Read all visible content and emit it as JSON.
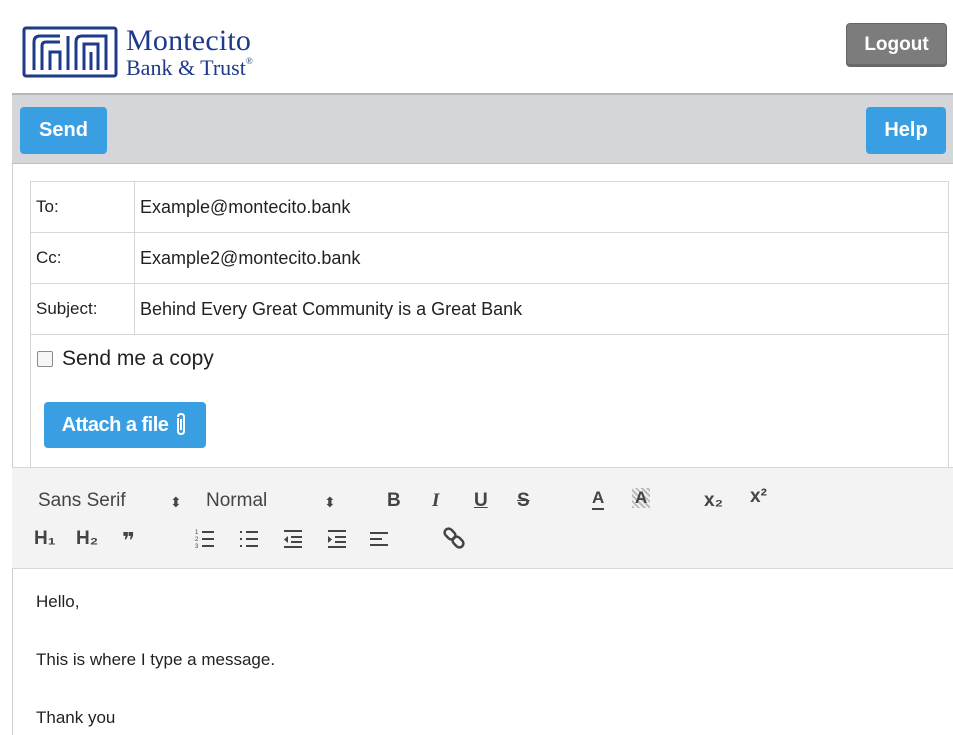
{
  "brand": {
    "name_line1": "Montecito",
    "name_line2": "Bank & Trust",
    "mark": "®"
  },
  "header": {
    "logout_label": "Logout"
  },
  "toolbar": {
    "send_label": "Send",
    "help_label": "Help"
  },
  "form": {
    "to_label": "To:",
    "to_value": "Example@montecito.bank",
    "cc_label": "Cc:",
    "cc_value": "Example2@montecito.bank",
    "subject_label": "Subject:",
    "subject_value": "Behind Every Great Community is a Great Bank",
    "copy_label": "Send me a copy",
    "copy_checked": false,
    "attach_label": "Attach a file"
  },
  "editor": {
    "font_picker": "Sans Serif",
    "size_picker": "Normal",
    "buttons": {
      "bold": "B",
      "italic": "I",
      "underline": "U",
      "strike": "S",
      "color": "A",
      "background": "A",
      "subscript": "x₂",
      "superscript": "x²",
      "header1": "H₁",
      "header2": "H₂",
      "quote": "❞"
    },
    "icons": [
      "bold-icon",
      "italic-icon",
      "underline-icon",
      "strike-icon",
      "text-color-icon",
      "background-color-icon",
      "subscript-icon",
      "superscript-icon",
      "header1-icon",
      "header2-icon",
      "blockquote-icon",
      "ordered-list-icon",
      "bullet-list-icon",
      "outdent-icon",
      "indent-icon",
      "align-icon",
      "link-icon"
    ]
  },
  "message": {
    "line1": "Hello,",
    "line2": "This is where I type a message.",
    "line3": "Thank you"
  },
  "colors": {
    "accent": "#3a9ee3",
    "brand": "#1e3a8a",
    "logout": "#7c7c7c"
  }
}
